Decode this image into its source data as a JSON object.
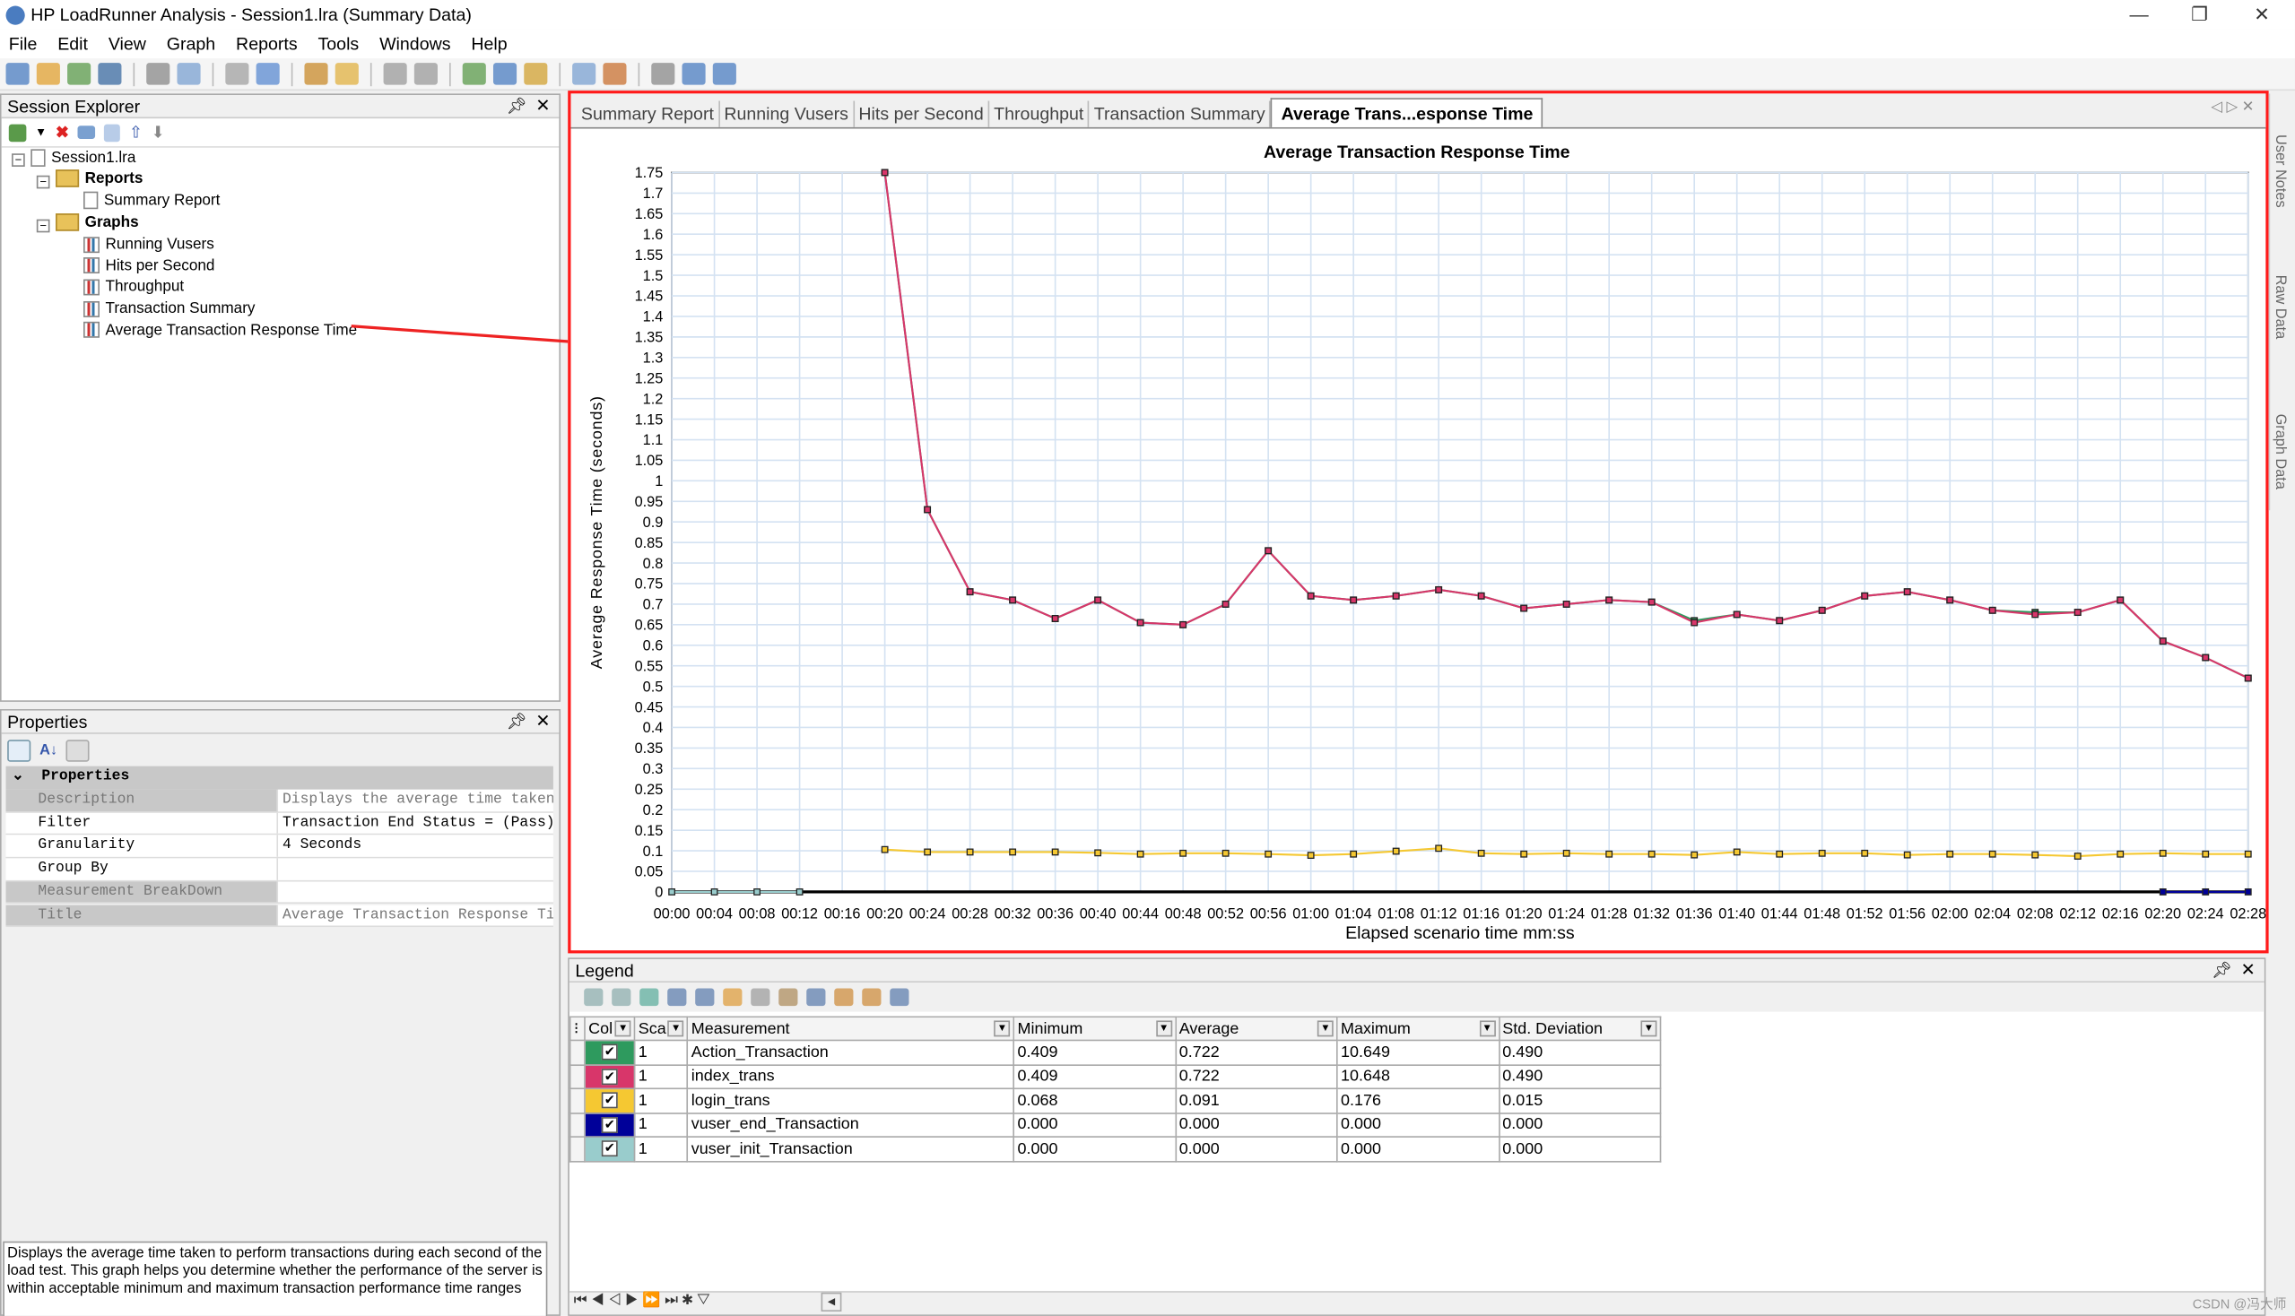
{
  "window": {
    "title": "HP LoadRunner Analysis - Session1.lra (Summary Data)",
    "minimize": "—",
    "restore": "❐",
    "close": "✕"
  },
  "menu": [
    "File",
    "Edit",
    "View",
    "Graph",
    "Reports",
    "Tools",
    "Windows",
    "Help"
  ],
  "session_explorer": {
    "title": "Session Explorer",
    "root": "Session1.lra",
    "reports_label": "Reports",
    "reports": [
      "Summary Report"
    ],
    "graphs_label": "Graphs",
    "graphs": [
      "Running Vusers",
      "Hits per Second",
      "Throughput",
      "Transaction Summary",
      "Average Transaction Response Time"
    ]
  },
  "properties": {
    "title": "Properties",
    "section": "Properties",
    "rows": [
      {
        "key": "Description",
        "value": "Displays the average time taken to",
        "dim": true
      },
      {
        "key": "Filter",
        "value": "Transaction End Status = (Pass)",
        "dim": false
      },
      {
        "key": "Granularity",
        "value": "4 Seconds",
        "dim": false
      },
      {
        "key": "Group By",
        "value": "",
        "dim": false
      },
      {
        "key": "Measurement BreakDown",
        "value": "",
        "dim": true
      },
      {
        "key": "Title",
        "value": "Average Transaction Response Time",
        "dim": true
      }
    ],
    "description_box": "Displays the average time taken to perform transactions during each second of the load test. This graph helps you determine whether the performance of the server is within acceptable minimum and maximum transaction performance time ranges"
  },
  "tabs": [
    "Summary Report",
    "Running Vusers",
    "Hits per Second",
    "Throughput",
    "Transaction Summary",
    "Average Trans...esponse Time"
  ],
  "active_tab": 5,
  "side_tabs": [
    "User Notes",
    "Raw Data",
    "Graph Data"
  ],
  "highlight_color": "#ff1a1a",
  "chart_data": {
    "type": "line",
    "title": "Average Transaction Response Time",
    "xlabel": "Elapsed scenario time mm:ss",
    "ylabel": "Average Response Time (seconds)",
    "ylim": [
      0,
      1.75
    ],
    "ystep": 0.05,
    "grid": true,
    "x": [
      "00:00",
      "00:04",
      "00:08",
      "00:12",
      "00:16",
      "00:20",
      "00:24",
      "00:28",
      "00:32",
      "00:36",
      "00:40",
      "00:44",
      "00:48",
      "00:52",
      "00:56",
      "01:00",
      "01:04",
      "01:08",
      "01:12",
      "01:16",
      "01:20",
      "01:24",
      "01:28",
      "01:32",
      "01:36",
      "01:40",
      "01:44",
      "01:48",
      "01:52",
      "01:56",
      "02:00",
      "02:04",
      "02:08",
      "02:12",
      "02:16",
      "02:20",
      "02:24",
      "02:28"
    ],
    "series": [
      {
        "name": "Action_Transaction",
        "color": "#2e9a5e",
        "start": "00:20",
        "values": [
          1.75,
          0.93,
          0.73,
          0.71,
          0.665,
          0.71,
          0.655,
          0.65,
          0.7,
          0.83,
          0.72,
          0.71,
          0.72,
          0.735,
          0.72,
          0.69,
          0.7,
          0.71,
          0.705,
          0.66,
          0.675,
          0.66,
          0.685,
          0.72,
          0.73,
          0.71,
          0.685,
          0.68,
          0.68,
          0.71,
          0.61,
          0.57,
          0.52
        ]
      },
      {
        "name": "index_trans",
        "color": "#d8366a",
        "start": "00:20",
        "values": [
          1.75,
          0.93,
          0.73,
          0.71,
          0.665,
          0.71,
          0.655,
          0.65,
          0.7,
          0.83,
          0.72,
          0.71,
          0.72,
          0.735,
          0.72,
          0.69,
          0.7,
          0.71,
          0.705,
          0.655,
          0.675,
          0.66,
          0.685,
          0.72,
          0.73,
          0.71,
          0.685,
          0.675,
          0.68,
          0.71,
          0.61,
          0.57,
          0.52
        ]
      },
      {
        "name": "login_trans",
        "color": "#f5c832",
        "start": "00:20",
        "values": [
          0.103,
          0.097,
          0.097,
          0.097,
          0.097,
          0.095,
          0.092,
          0.094,
          0.094,
          0.092,
          0.089,
          0.092,
          0.099,
          0.106,
          0.094,
          0.092,
          0.094,
          0.092,
          0.092,
          0.09,
          0.097,
          0.092,
          0.094,
          0.094,
          0.09,
          0.092,
          0.092,
          0.09,
          0.087,
          0.092,
          0.094,
          0.092,
          0.092
        ]
      },
      {
        "name": "vuser_end_Transaction",
        "color": "#000099",
        "start": "02:20",
        "values": [
          0,
          0,
          0
        ]
      },
      {
        "name": "vuser_init_Transaction",
        "color": "#99cccc",
        "start": "00:00",
        "values": [
          0,
          0,
          0,
          0
        ]
      }
    ]
  },
  "legend": {
    "title": "Legend",
    "columns": [
      "Col",
      "Sca",
      "Measurement",
      "Minimum",
      "Average",
      "Maximum",
      "Std. Deviation"
    ],
    "rows": [
      {
        "color": "#2e9a5e",
        "checked": "✔",
        "scale": "1",
        "measurement": "Action_Transaction",
        "min": "0.409",
        "avg": "0.722",
        "max": "10.649",
        "std": "0.490"
      },
      {
        "color": "#d8366a",
        "checked": "✔",
        "scale": "1",
        "measurement": "index_trans",
        "min": "0.409",
        "avg": "0.722",
        "max": "10.648",
        "std": "0.490"
      },
      {
        "color": "#f5c832",
        "checked": "✔",
        "scale": "1",
        "measurement": "login_trans",
        "min": "0.068",
        "avg": "0.091",
        "max": "0.176",
        "std": "0.015"
      },
      {
        "color": "#000099",
        "checked": "✔",
        "scale": "1",
        "measurement": "vuser_end_Transaction",
        "min": "0.000",
        "avg": "0.000",
        "max": "0.000",
        "std": "0.000"
      },
      {
        "color": "#99cccc",
        "checked": "✔",
        "scale": "1",
        "measurement": "vuser_init_Transaction",
        "min": "0.000",
        "avg": "0.000",
        "max": "0.000",
        "std": "0.000"
      }
    ]
  },
  "watermark": "CSDN @冯大师"
}
